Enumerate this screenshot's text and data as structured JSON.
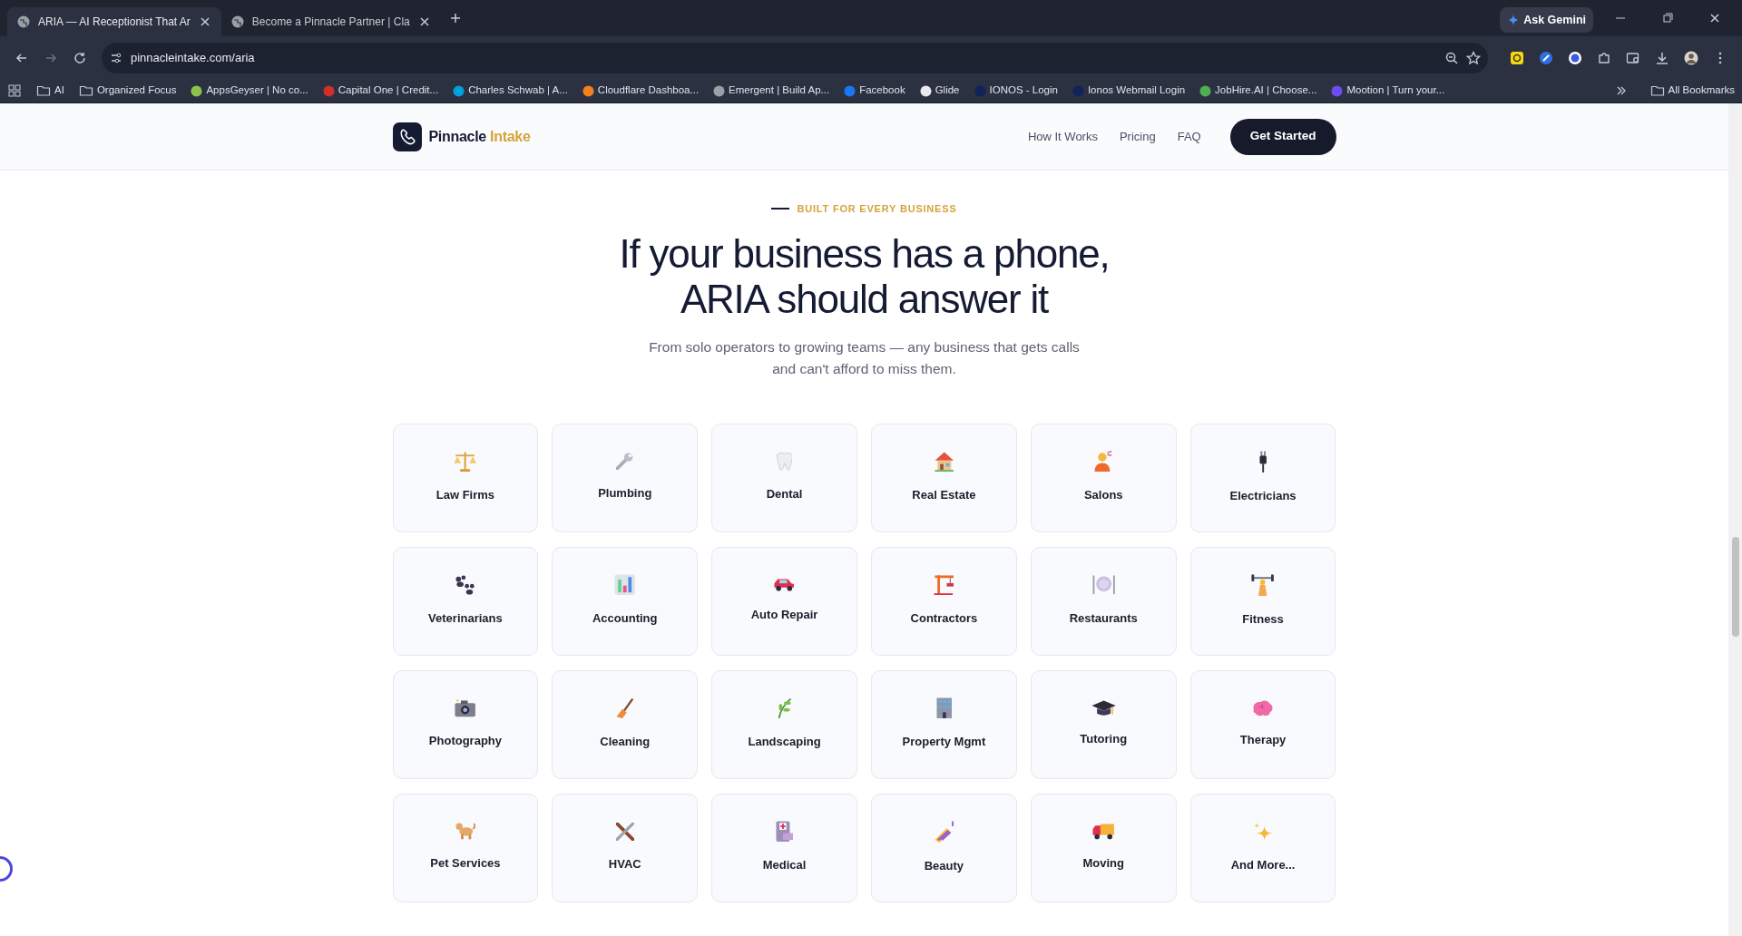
{
  "browser": {
    "tabs": [
      {
        "title": "ARIA — AI Receptionist That Ar",
        "selected": true
      },
      {
        "title": "Become a Pinnacle Partner | Cla",
        "selected": false
      }
    ],
    "ask_gemini": "Ask Gemini",
    "address": "pinnacleintake.com/aria",
    "bookmarks": [
      {
        "kind": "folder",
        "label": "AI"
      },
      {
        "kind": "folder",
        "label": "Organized Focus"
      },
      {
        "kind": "site",
        "label": "AppsGeyser | No co...",
        "color": "#8bc34a"
      },
      {
        "kind": "site",
        "label": "Capital One | Credit...",
        "color": "#d03027"
      },
      {
        "kind": "site",
        "label": "Charles Schwab | A...",
        "color": "#00a0df"
      },
      {
        "kind": "site",
        "label": "Cloudflare Dashboa...",
        "color": "#f38020"
      },
      {
        "kind": "site",
        "label": "Emergent | Build Ap...",
        "color": "#9aa0a6"
      },
      {
        "kind": "site",
        "label": "Facebook",
        "color": "#1877f2"
      },
      {
        "kind": "site",
        "label": "Glide",
        "color": "#e8eaed"
      },
      {
        "kind": "site",
        "label": "IONOS - Login",
        "color": "#11235a"
      },
      {
        "kind": "site",
        "label": "Ionos Webmail Login",
        "color": "#11235a"
      },
      {
        "kind": "site",
        "label": "JobHire.AI | Choose...",
        "color": "#4caf50"
      },
      {
        "kind": "site",
        "label": "Mootion | Turn your...",
        "color": "#6c4cf5"
      }
    ],
    "all_bookmarks": "All Bookmarks"
  },
  "header": {
    "brand": "Pinnacle",
    "brand_accent": "Intake",
    "nav": [
      "How It Works",
      "Pricing",
      "FAQ"
    ],
    "cta": "Get Started"
  },
  "section": {
    "eyebrow": "BUILT FOR EVERY BUSINESS",
    "title_lines": [
      "If your business has a phone,",
      "ARIA should answer it"
    ],
    "subtitle": "From solo operators to growing teams — any business that gets calls and can't afford to miss them.",
    "cards": [
      {
        "label": "Law Firms"
      },
      {
        "label": "Plumbing"
      },
      {
        "label": "Dental"
      },
      {
        "label": "Real Estate"
      },
      {
        "label": "Salons"
      },
      {
        "label": "Electricians"
      },
      {
        "label": "Veterinarians"
      },
      {
        "label": "Accounting"
      },
      {
        "label": "Auto Repair"
      },
      {
        "label": "Contractors"
      },
      {
        "label": "Restaurants"
      },
      {
        "label": "Fitness"
      },
      {
        "label": "Photography"
      },
      {
        "label": "Cleaning"
      },
      {
        "label": "Landscaping"
      },
      {
        "label": "Property Mgmt"
      },
      {
        "label": "Tutoring"
      },
      {
        "label": "Therapy"
      },
      {
        "label": "Pet Services"
      },
      {
        "label": "HVAC"
      },
      {
        "label": "Medical"
      },
      {
        "label": "Beauty"
      },
      {
        "label": "Moving"
      },
      {
        "label": "And More..."
      }
    ]
  }
}
